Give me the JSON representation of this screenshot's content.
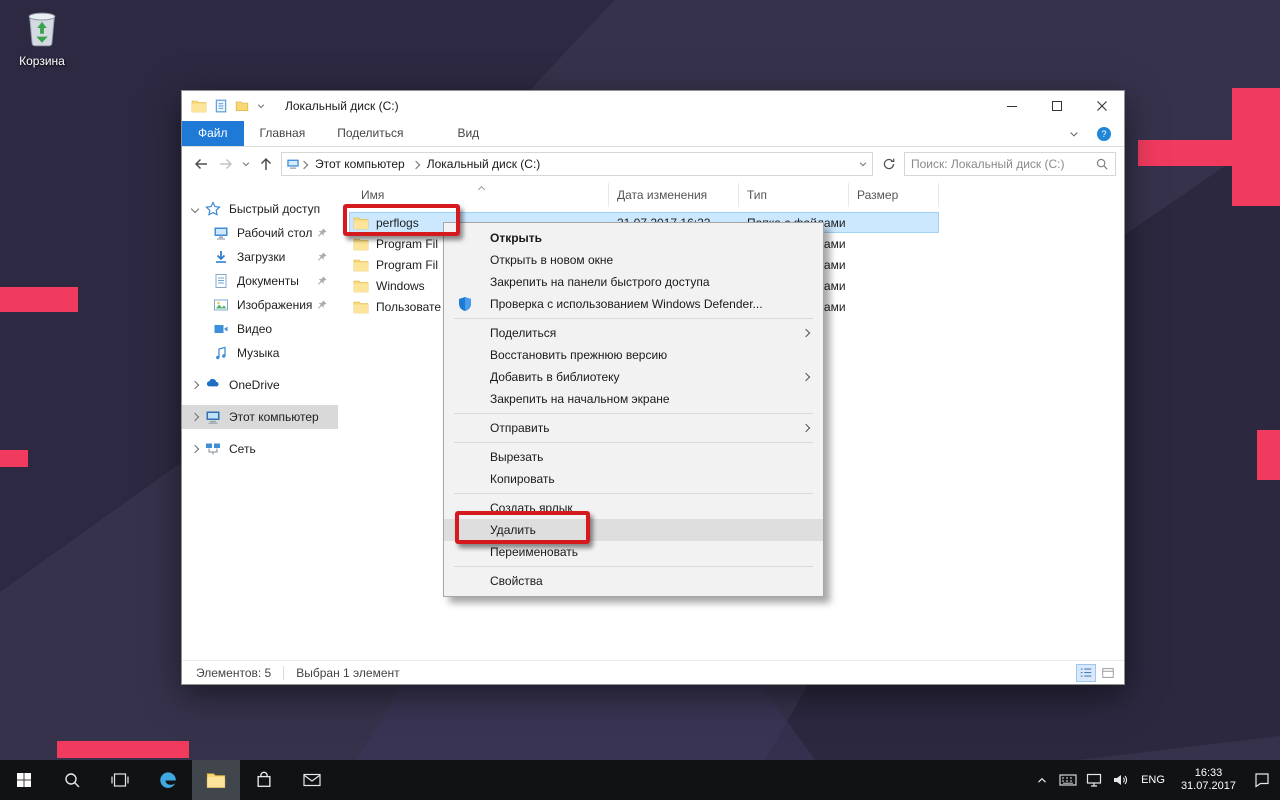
{
  "colors": {
    "accent_pink": "#f13b5e",
    "annotation_red": "#d41a1f",
    "selection_blue": "#cce8ff",
    "file_tab_blue": "#1e7ad6"
  },
  "desktop": {
    "recycle_bin_label": "Корзина"
  },
  "explorer": {
    "title": "Локальный диск (C:)",
    "ribbon_tabs": [
      "Файл",
      "Главная",
      "Поделиться",
      "Вид"
    ],
    "address": {
      "breadcrumb": [
        "Этот компьютер",
        "Локальный диск (C:)"
      ],
      "search_placeholder": "Поиск: Локальный диск (C:)"
    },
    "sidebar": [
      {
        "label": "Быстрый доступ",
        "icon": "star",
        "chevron": "down"
      },
      {
        "label": "Рабочий стол",
        "icon": "desktop",
        "pin": true,
        "indent": true
      },
      {
        "label": "Загрузки",
        "icon": "downloads",
        "pin": true,
        "indent": true
      },
      {
        "label": "Документы",
        "icon": "document",
        "pin": true,
        "indent": true
      },
      {
        "label": "Изображения",
        "icon": "pictures",
        "pin": true,
        "indent": true
      },
      {
        "label": "Видео",
        "icon": "video",
        "indent": true
      },
      {
        "label": "Музыка",
        "icon": "music",
        "indent": true
      },
      {
        "label": "OneDrive",
        "icon": "onedrive",
        "chevron": "right",
        "group": true
      },
      {
        "label": "Этот компьютер",
        "icon": "computer",
        "chevron": "right",
        "group": true,
        "selected": true
      },
      {
        "label": "Сеть",
        "icon": "network",
        "chevron": "right",
        "group": true
      }
    ],
    "columns": [
      "Имя",
      "Дата изменения",
      "Тип",
      "Размер"
    ],
    "files": [
      {
        "name": "perflogs",
        "date": "21.07.2017 16:22",
        "type": "Папка с файлами",
        "size": "",
        "selected": true
      },
      {
        "name": "Program Fil",
        "type": "Папка с файлами"
      },
      {
        "name": "Program Fil",
        "type": "Папка с файлами"
      },
      {
        "name": "Windows",
        "type": "Папка с файлами"
      },
      {
        "name": "Пользовате",
        "type": "Папка с файлами"
      }
    ],
    "status": {
      "count": "Элементов: 5",
      "selected": "Выбран 1 элемент"
    }
  },
  "context_menu": {
    "items": [
      {
        "label": "Открыть",
        "bold": true
      },
      {
        "label": "Открыть в новом окне"
      },
      {
        "label": "Закрепить на панели быстрого доступа"
      },
      {
        "label": "Проверка с использованием Windows Defender...",
        "icon": "defender"
      },
      {
        "separator": true
      },
      {
        "label": "Поделиться",
        "submenu": true
      },
      {
        "label": "Восстановить прежнюю версию"
      },
      {
        "label": "Добавить в библиотеку",
        "submenu": true
      },
      {
        "label": "Закрепить на начальном экране"
      },
      {
        "separator": true
      },
      {
        "label": "Отправить",
        "submenu": true
      },
      {
        "separator": true
      },
      {
        "label": "Вырезать"
      },
      {
        "label": "Копировать"
      },
      {
        "separator": true
      },
      {
        "label": "Создать ярлык"
      },
      {
        "label": "Удалить",
        "highlight": true
      },
      {
        "label": "Переименовать"
      },
      {
        "separator": true
      },
      {
        "label": "Свойства"
      }
    ]
  },
  "taskbar": {
    "tray": {
      "lang": "ENG",
      "time": "16:33",
      "date": "31.07.2017"
    }
  }
}
